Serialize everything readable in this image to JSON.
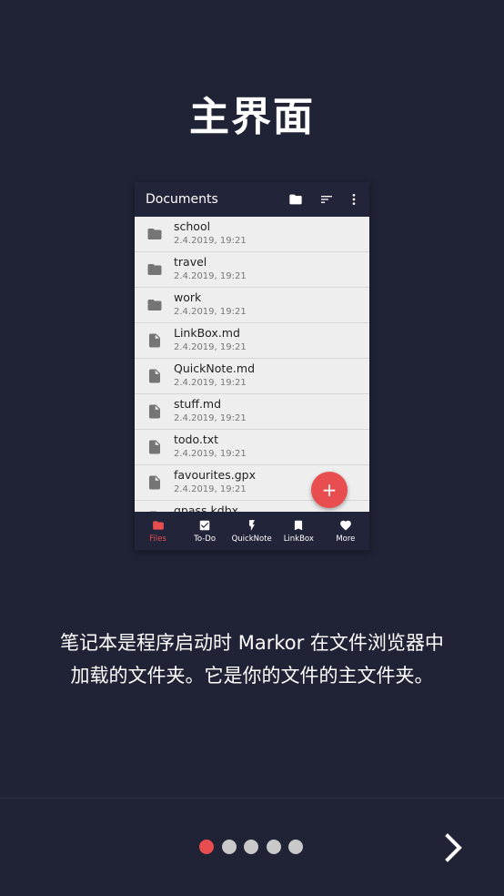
{
  "page": {
    "title": "主界面",
    "description_line1": "笔记本是程序启动时 Markor 在文件浏览器中",
    "description_line2": "加载的文件夹。它是你的文件的主文件夹。"
  },
  "preview": {
    "toolbar_title": "Documents",
    "toolbar_icons": [
      "folder-icon",
      "sort-icon",
      "more-vert-icon"
    ],
    "files": [
      {
        "name": "school",
        "date": "2.4.2019, 19:21",
        "icon": "folder-icon"
      },
      {
        "name": "travel",
        "date": "2.4.2019, 19:21",
        "icon": "folder-icon"
      },
      {
        "name": "work",
        "date": "2.4.2019, 19:21",
        "icon": "folder-icon"
      },
      {
        "name": "LinkBox.md",
        "date": "2.4.2019, 19:21",
        "icon": "file-icon"
      },
      {
        "name": "QuickNote.md",
        "date": "2.4.2019, 19:21",
        "icon": "file-icon"
      },
      {
        "name": "stuff.md",
        "date": "2.4.2019, 19:21",
        "icon": "file-icon"
      },
      {
        "name": "todo.txt",
        "date": "2.4.2019, 19:21",
        "icon": "file-icon"
      },
      {
        "name": "favourites.gpx",
        "date": "2.4.2019, 19:21",
        "icon": "file-icon"
      },
      {
        "name": "gpass.kdbx",
        "date": "",
        "icon": "file-icon"
      }
    ],
    "fab_label": "+",
    "tabs": [
      {
        "label": "Files",
        "icon": "folder-icon",
        "active": true
      },
      {
        "label": "To-Do",
        "icon": "checkbox-icon",
        "active": false
      },
      {
        "label": "QuickNote",
        "icon": "lightning-icon",
        "active": false
      },
      {
        "label": "LinkBox",
        "icon": "bookmark-icon",
        "active": false
      },
      {
        "label": "More",
        "icon": "heart-icon",
        "active": false
      }
    ]
  },
  "pager": {
    "total_pages": 5,
    "current_page": 1,
    "next_icon": "chevron-right-icon"
  },
  "colors": {
    "background": "#1f2335",
    "accent": "#e84e4f",
    "inactive_dot": "#c9c9c9",
    "toolbar": "#22243a"
  }
}
